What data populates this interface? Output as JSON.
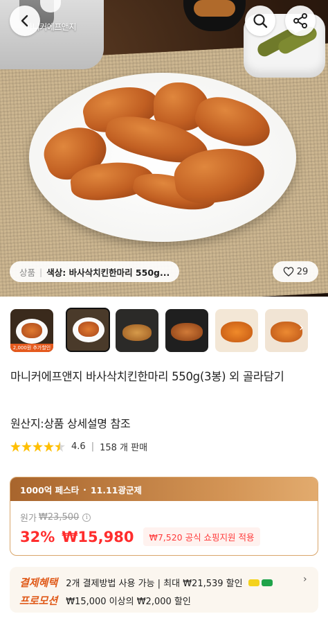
{
  "header": {
    "brand_logo_text": "마니커에프앤지",
    "back_icon": "chevron-left-icon",
    "search_icon": "search-icon",
    "share_icon": "share-icon"
  },
  "hero": {
    "category_label": "상품",
    "option_label": "색상: 바사삭치킨한마리 550g...",
    "like_count": "29"
  },
  "thumbnails": [
    {
      "caption": "2,000원 추가할인",
      "selected": false
    },
    {
      "caption": "",
      "selected": true
    },
    {
      "caption": "",
      "selected": false
    },
    {
      "caption": "",
      "selected": false
    },
    {
      "caption": "",
      "selected": false
    },
    {
      "caption": "",
      "selected": false
    }
  ],
  "product": {
    "title": "마니커에프앤지 바사삭치킨한마리 550g(3봉) 외 골라담기",
    "origin": "원산지:상품 상세설명 참조",
    "rating": "4.6",
    "rating_value": 4.6,
    "sold": "158 개 판매"
  },
  "price": {
    "banner_left": "1000억 페스타",
    "banner_right": "11.11광군제",
    "original_label": "원가",
    "original_price": "₩23,500",
    "discount": "32%",
    "final_price": "₩15,980",
    "support": "₩7,520 공식 쇼핑지원 적용"
  },
  "benefits": {
    "payment_tag": "결제혜택",
    "payment_text": "2개 결제방법 사용 가능 | 최대 ₩21,539 할인",
    "promotion_tag": "프로모션",
    "promotion_text": "₩15,000 이상의 ₩2,000 할인"
  },
  "colors": {
    "accent_red": "#ff2d2d",
    "promo_orange": "#e05a1a",
    "star": "#ffbf00"
  }
}
